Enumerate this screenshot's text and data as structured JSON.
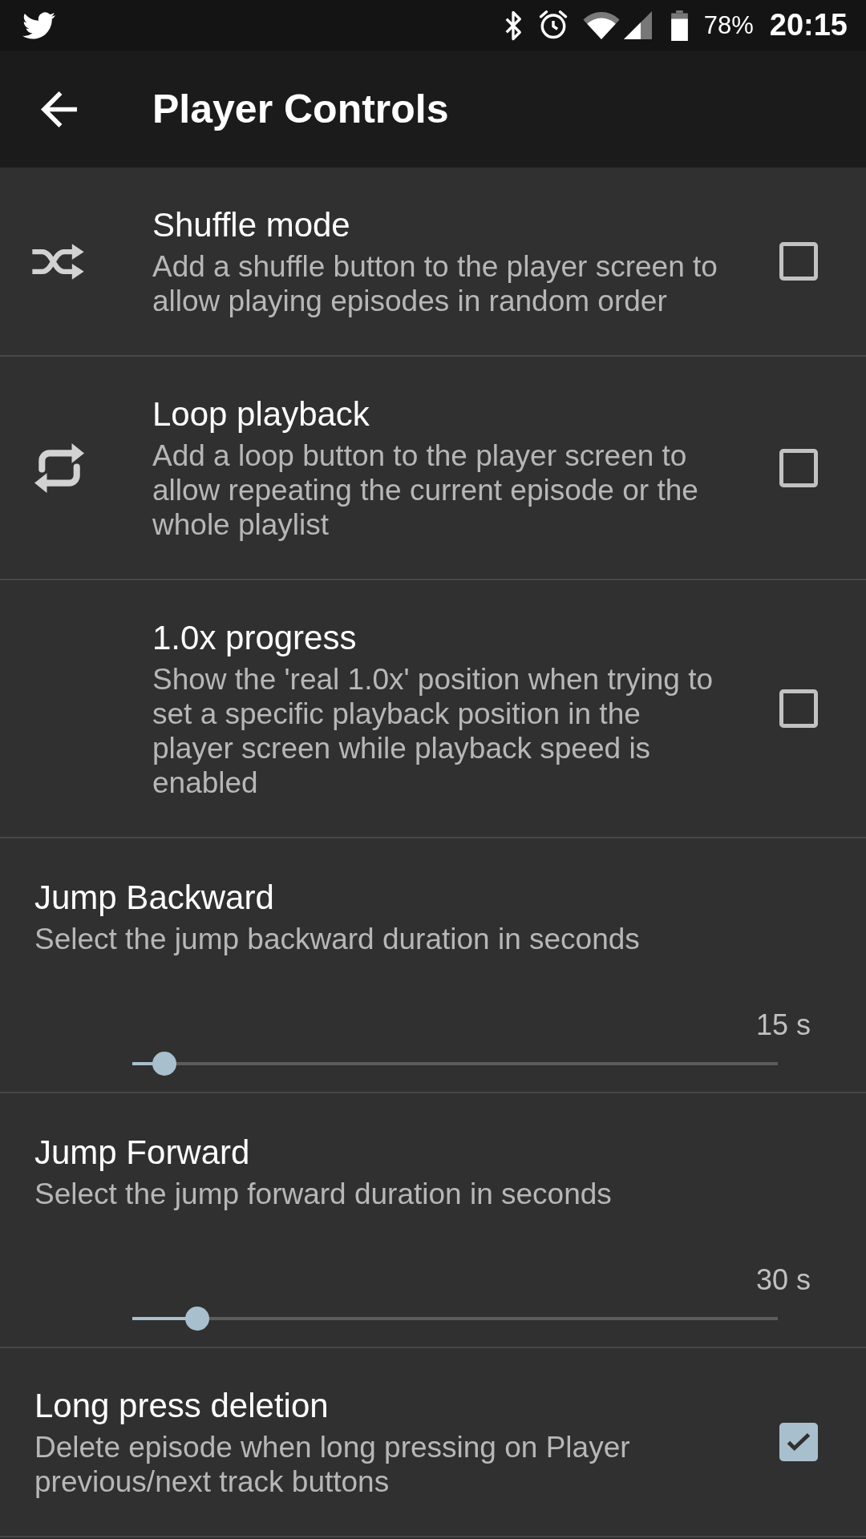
{
  "status_bar": {
    "battery_text": "78%",
    "time": "20:15"
  },
  "app_bar": {
    "title": "Player Controls"
  },
  "groups": [
    {
      "indented": true,
      "items": [
        {
          "kind": "checkbox",
          "title": "Shuffle mode",
          "summary": "Add a shuffle button to the player screen to allow playing episodes in random order",
          "checked": false
        },
        {
          "kind": "checkbox",
          "title": "Loop playback",
          "summary": "Add a loop button to the player screen to allow repeating the current episode or the whole playlist",
          "checked": false
        },
        {
          "kind": "checkbox",
          "title": "1.0x progress",
          "summary": "Show the 'real 1.0x' position when trying to set a specific playback position in the player screen while playback speed is enabled",
          "checked": false
        }
      ]
    },
    {
      "indented": false,
      "items": [
        {
          "kind": "slider",
          "title": "Jump Backward",
          "summary": "Select the jump backward duration in seconds",
          "value": "15 s",
          "level": 0.05
        },
        {
          "kind": "slider",
          "title": "Jump Forward",
          "summary": "Select the jump forward duration in seconds",
          "value": "30 s",
          "level": 0.1
        },
        {
          "kind": "checkbox",
          "title": "Long press deletion",
          "summary": "Delete episode when long pressing on Player previous/next track buttons",
          "checked": true
        }
      ]
    }
  ]
}
